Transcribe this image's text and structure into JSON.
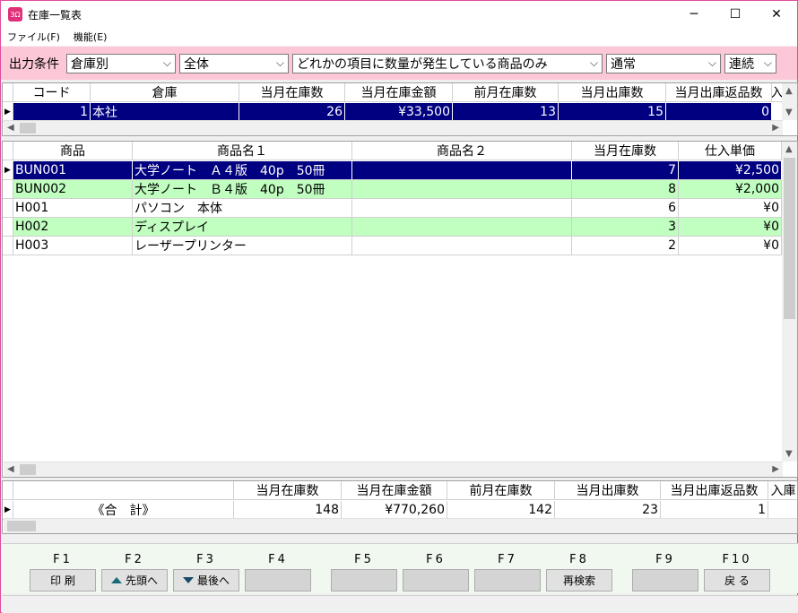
{
  "window": {
    "title": "在庫一覧表",
    "icon_text": "3Ω",
    "minimize": "─",
    "maximize": "☐",
    "close": "✕"
  },
  "menu": [
    "ファイル(F)",
    "機能(E)"
  ],
  "filter": {
    "label": "出力条件",
    "combos": [
      "倉庫別",
      "全体",
      "どれかの項目に数量が発生している商品のみ",
      "通常",
      "連続"
    ]
  },
  "warehouse_grid": {
    "headers": [
      "コード",
      "倉庫",
      "当月在庫数",
      "当月在庫金額",
      "前月在庫数",
      "当月出庫数",
      "当月出庫返品数",
      "入"
    ],
    "rows": [
      [
        "1",
        "本社",
        "26",
        "¥33,500",
        "13",
        "15",
        "0",
        ""
      ]
    ]
  },
  "product_grid": {
    "headers": [
      "商品",
      "商品名１",
      "商品名２",
      "当月在庫数",
      "仕入単価"
    ],
    "rows": [
      [
        "BUN001",
        "大学ノート　Ａ４版　40p　50冊",
        "",
        "7",
        "¥2,500"
      ],
      [
        "BUN002",
        "大学ノート　Ｂ４版　40p　50冊",
        "",
        "8",
        "¥2,000"
      ],
      [
        "H001",
        "パソコン　本体",
        "",
        "6",
        "¥0"
      ],
      [
        "H002",
        "ディスプレイ",
        "",
        "3",
        "¥0"
      ],
      [
        "H003",
        "レーザープリンター",
        "",
        "2",
        "¥0"
      ]
    ]
  },
  "totals_grid": {
    "headers": [
      "",
      "当月在庫数",
      "当月在庫金額",
      "前月在庫数",
      "当月出庫数",
      "当月出庫返品数",
      "入庫"
    ],
    "row": [
      "《合　計》",
      "148",
      "¥770,260",
      "142",
      "23",
      "1",
      ""
    ]
  },
  "fkeys": [
    {
      "key": "F1",
      "label": "印 刷",
      "icon": ""
    },
    {
      "key": "F2",
      "label": "先頭へ",
      "icon": "up-arrow-icon"
    },
    {
      "key": "F3",
      "label": "最後へ",
      "icon": "down-arrow-icon"
    },
    {
      "key": "F4",
      "label": "",
      "icon": ""
    },
    {
      "key": "F5",
      "label": "",
      "icon": ""
    },
    {
      "key": "F6",
      "label": "",
      "icon": ""
    },
    {
      "key": "F7",
      "label": "",
      "icon": ""
    },
    {
      "key": "F8",
      "label": "再検索",
      "icon": ""
    },
    {
      "key": "F9",
      "label": "",
      "icon": ""
    },
    {
      "key": "F10",
      "label": "戻 る",
      "icon": ""
    }
  ],
  "colors": {
    "selected": "#000080",
    "alt_row": "#c0ffc0",
    "filter_bg": "#fcc8d8",
    "accent": "#e04c9c"
  }
}
